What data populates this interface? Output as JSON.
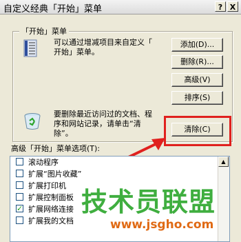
{
  "window": {
    "title": "自定义经典「开始」菜单",
    "help_button": "?",
    "close_button": "X"
  },
  "group": {
    "legend": "「开始」菜单",
    "description_line1": "可以通过增减项目来自定义「",
    "description_line2": "开始」菜单。",
    "recycle_text_line1": "要删除最近访问过的文档、程",
    "recycle_text_line2": "序和网站记录，请单击“清",
    "recycle_text_line3": "除”。"
  },
  "buttons": {
    "add": "添加(D)...",
    "remove": "删除(R)...",
    "advanced": "高级(V)",
    "sort": "排序(S)",
    "clear": "清除(C)"
  },
  "advanced_options": {
    "label": "高级「开始」菜单选项(T):",
    "items": [
      {
        "label": "滚动程序",
        "checked": false
      },
      {
        "label": "扩展“图片收藏”",
        "checked": false
      },
      {
        "label": "扩展打印机",
        "checked": false
      },
      {
        "label": "扩展控制面板",
        "checked": false
      },
      {
        "label": "扩展网络连接",
        "checked": true
      },
      {
        "label": "扩展我的文档",
        "checked": false
      }
    ]
  },
  "watermark": {
    "text": "技术员联盟",
    "url": "www.jsgho.com"
  },
  "colors": {
    "highlight": "#e0201e",
    "watermark_green": "#3fae3f",
    "watermark_orange": "#e06a14"
  }
}
